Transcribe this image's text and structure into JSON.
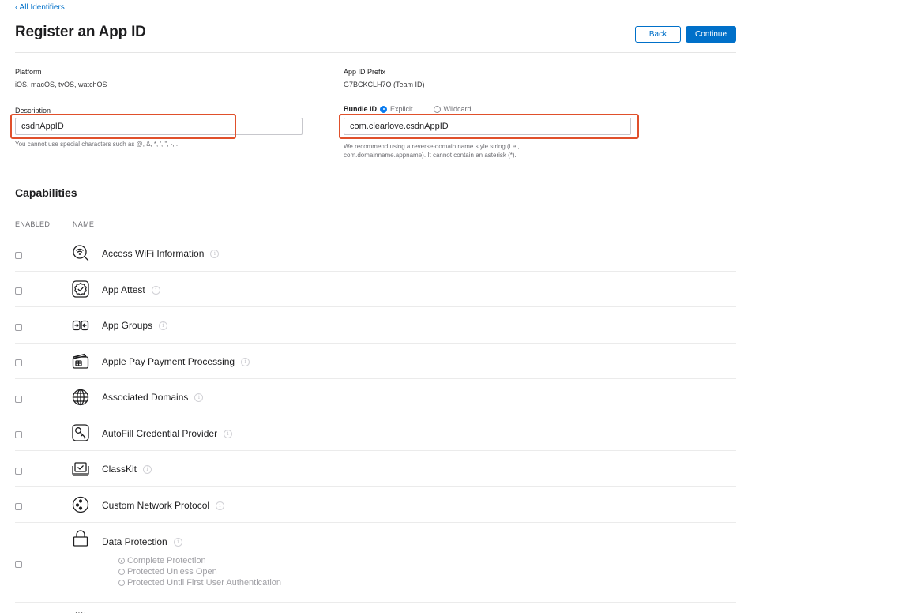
{
  "breadcrumb": "‹ All Identifiers",
  "page_title": "Register an App ID",
  "buttons": {
    "back": "Back",
    "continue": "Continue"
  },
  "platform": {
    "label": "Platform",
    "value": "iOS, macOS, tvOS, watchOS"
  },
  "prefix": {
    "label": "App ID Prefix",
    "value": "G7BCKCLH7Q (Team ID)"
  },
  "description": {
    "label": "Description",
    "value": "csdnAppID",
    "hint": "You cannot use special characters such as @, &, *, ', \", -, ."
  },
  "bundle": {
    "label": "Bundle ID",
    "explicit": "Explicit",
    "wildcard": "Wildcard",
    "value": "com.clearlove.csdnAppID",
    "hint1": "We recommend using a reverse-domain name style string (i.e.,",
    "hint2": "com.domainname.appname). It cannot contain an asterisk (*)."
  },
  "capabilities": {
    "title": "Capabilities",
    "col_enabled": "ENABLED",
    "col_name": "NAME",
    "items": [
      {
        "name": "Access WiFi Information",
        "icon": "wifi-search-icon"
      },
      {
        "name": "App Attest",
        "icon": "badge-check-icon"
      },
      {
        "name": "App Groups",
        "icon": "app-groups-icon"
      },
      {
        "name": "Apple Pay Payment Processing",
        "icon": "wallet-card-icon"
      },
      {
        "name": "Associated Domains",
        "icon": "globe-icon"
      },
      {
        "name": "AutoFill Credential Provider",
        "icon": "key-icon"
      },
      {
        "name": "ClassKit",
        "icon": "classkit-icon"
      },
      {
        "name": "Custom Network Protocol",
        "icon": "network-dots-icon"
      },
      {
        "name": "Data Protection",
        "icon": "lock-icon"
      }
    ],
    "data_protection_options": [
      "Complete Protection",
      "Protected Unless Open",
      "Protected Until First User Authentication"
    ]
  },
  "colors": {
    "accent": "#0070c9",
    "highlight": "#e0502b"
  }
}
